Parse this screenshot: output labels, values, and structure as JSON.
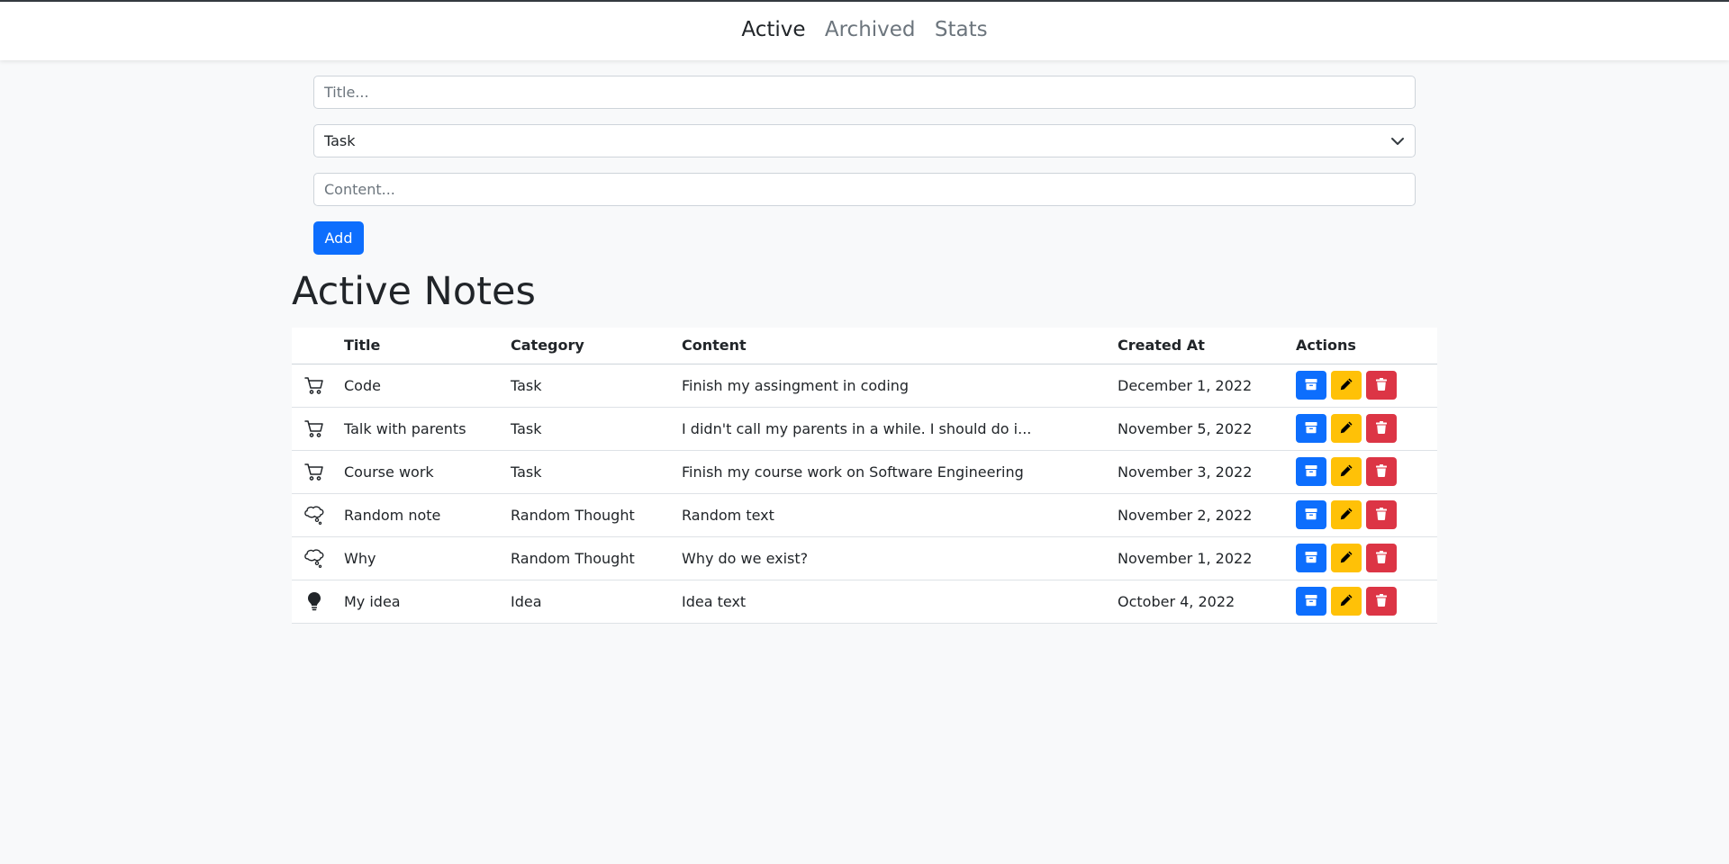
{
  "nav": {
    "tabs": [
      {
        "label": "Active",
        "active": true
      },
      {
        "label": "Archived",
        "active": false
      },
      {
        "label": "Stats",
        "active": false
      }
    ]
  },
  "form": {
    "title_placeholder": "Title...",
    "category_value": "Task",
    "content_placeholder": "Content...",
    "add_label": "Add"
  },
  "page": {
    "heading": "Active Notes"
  },
  "table": {
    "headers": {
      "title": "Title",
      "category": "Category",
      "content": "Content",
      "created": "Created At",
      "actions": "Actions"
    },
    "rows": [
      {
        "icon": "cart-icon",
        "title": "Code",
        "category": "Task",
        "content": "Finish my assingment in coding",
        "created": "December 1, 2022"
      },
      {
        "icon": "cart-icon",
        "title": "Talk with parents",
        "category": "Task",
        "content": "I didn't call my parents in a while. I should do i...",
        "created": "November 5, 2022"
      },
      {
        "icon": "cart-icon",
        "title": "Course work",
        "category": "Task",
        "content": "Finish my course work on Software Engineering",
        "created": "November 3, 2022"
      },
      {
        "icon": "thought-bubble-icon",
        "title": "Random note",
        "category": "Random Thought",
        "content": "Random text",
        "created": "November 2, 2022"
      },
      {
        "icon": "thought-bubble-icon",
        "title": "Why",
        "category": "Random Thought",
        "content": "Why do we exist?",
        "created": "November 1, 2022"
      },
      {
        "icon": "lightbulb-icon",
        "title": "My idea",
        "category": "Idea",
        "content": "Idea text",
        "created": "October 4, 2022"
      }
    ]
  },
  "colors": {
    "primary": "#0d6efd",
    "warning": "#ffc107",
    "danger": "#dc3545",
    "background": "#f8f9fa"
  }
}
